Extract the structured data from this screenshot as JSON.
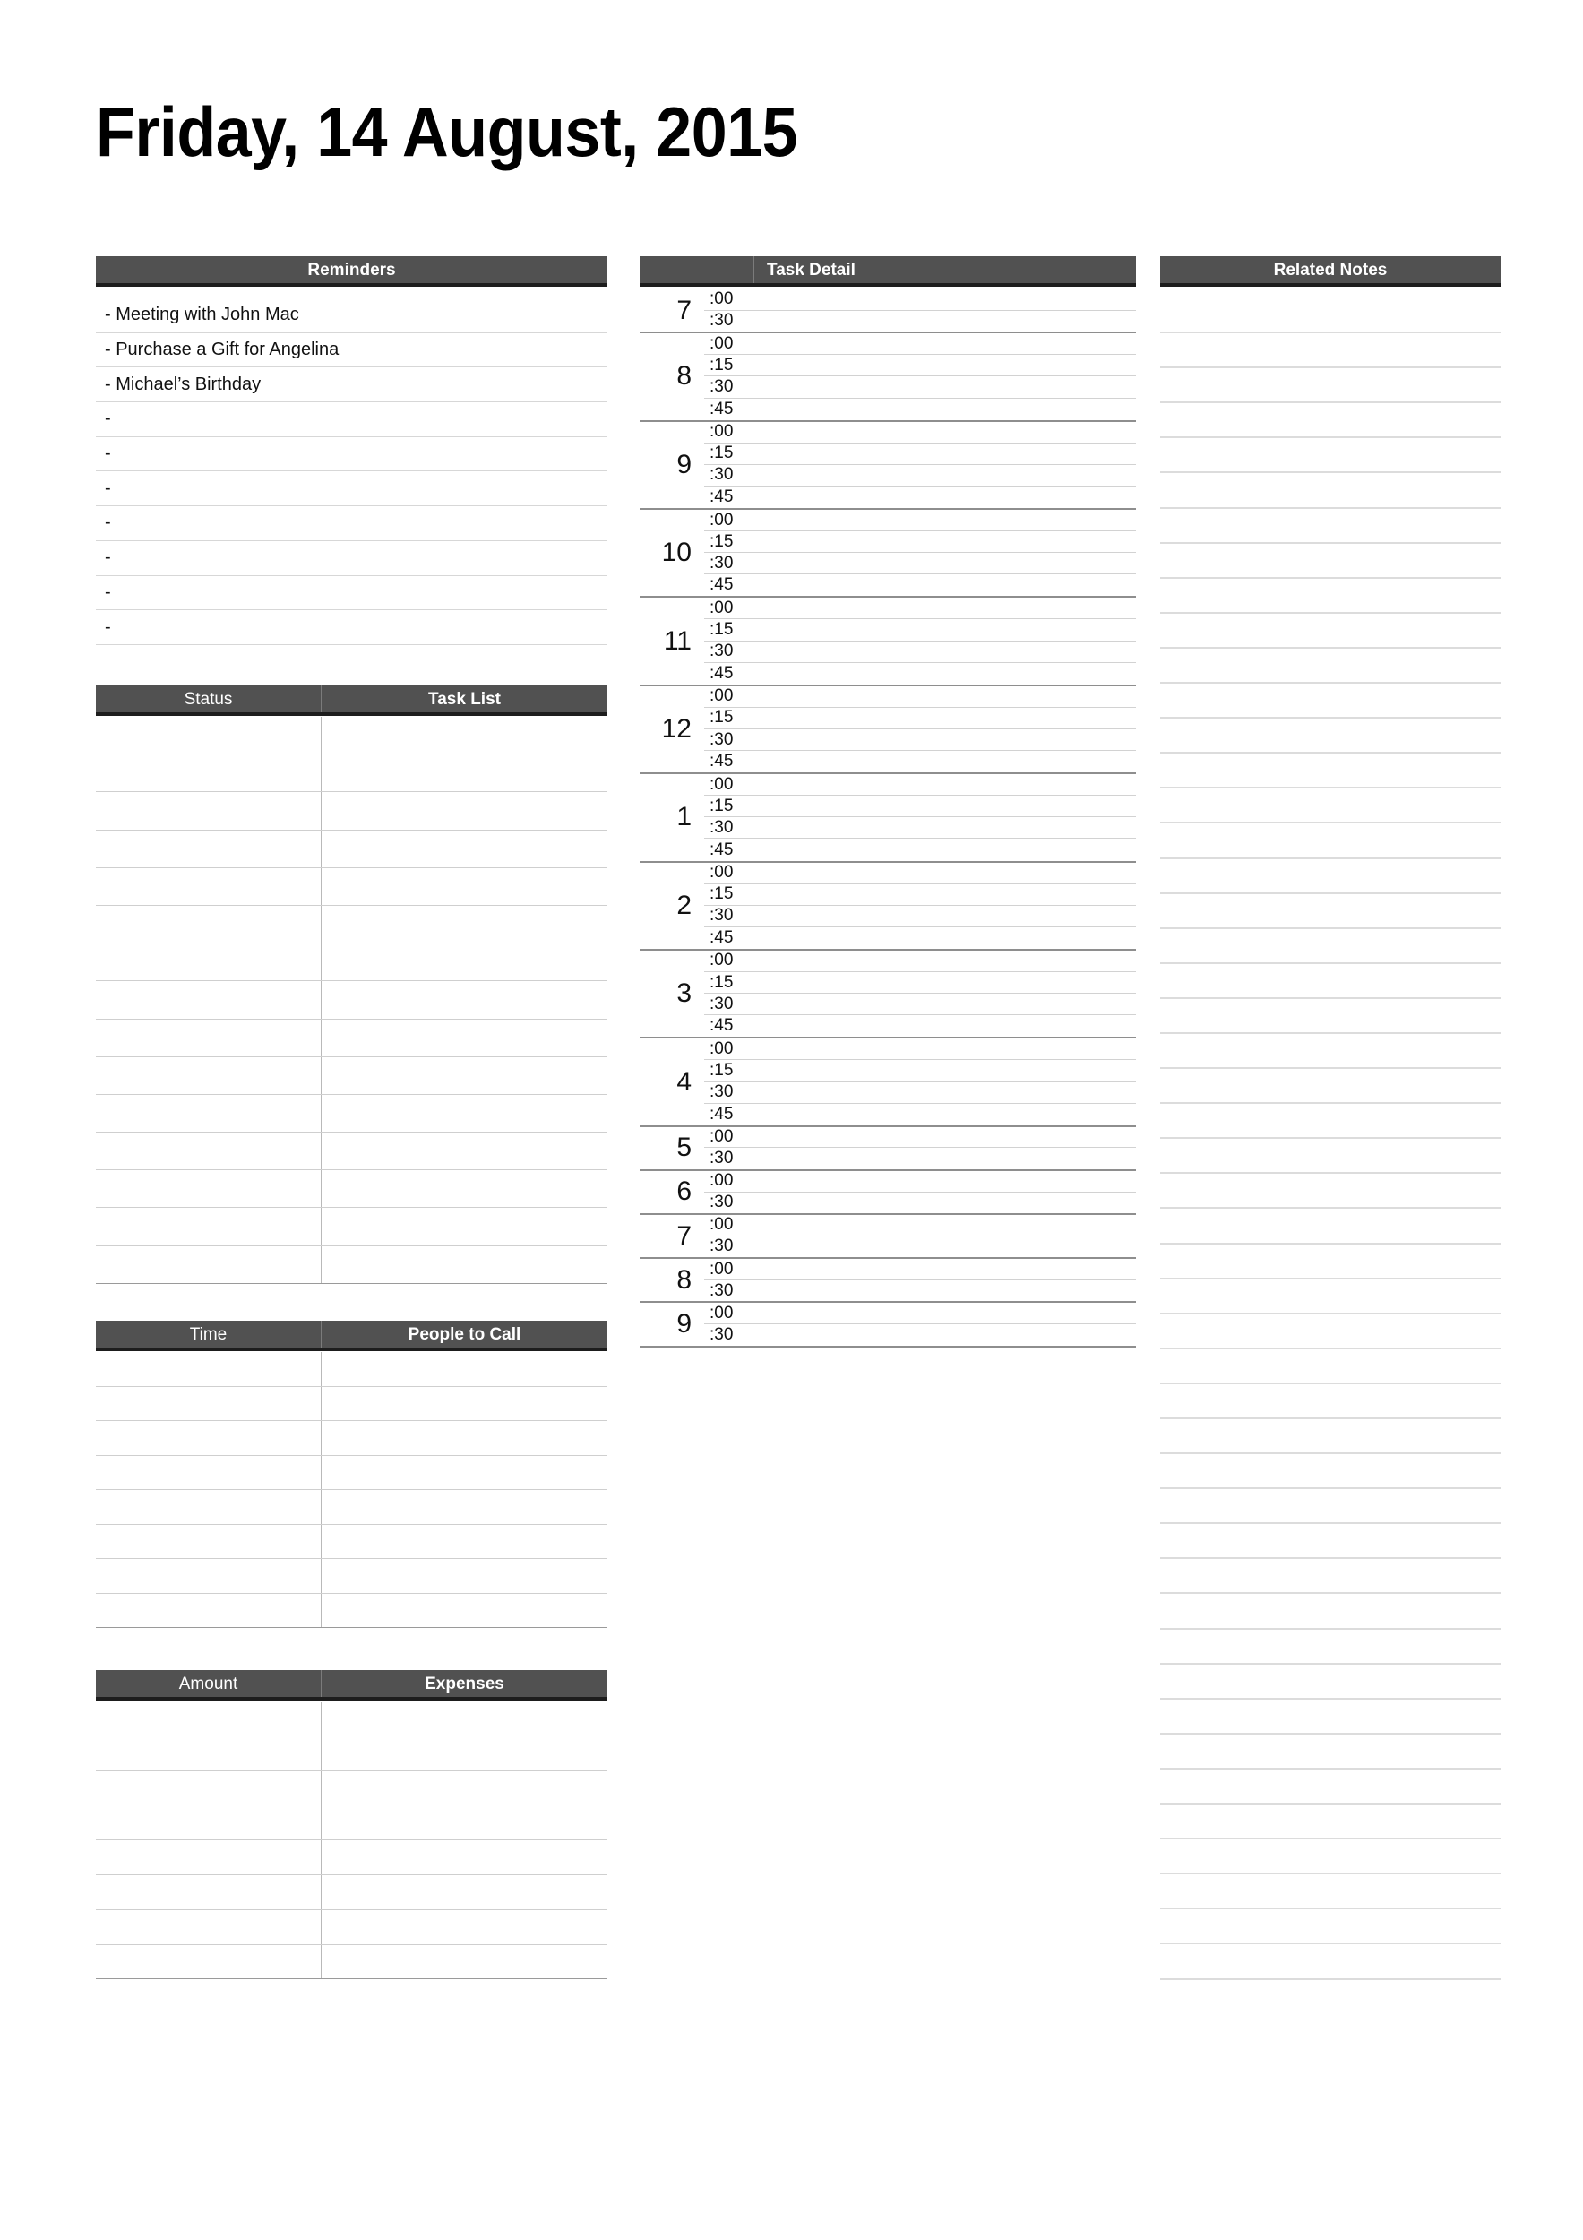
{
  "page": {
    "title": "Friday, 14 August, 2015",
    "background_color": "#ffffff",
    "header_bar_color": "#515151",
    "header_text_color": "#ffffff",
    "rule_color": "#d2d2d2"
  },
  "reminders": {
    "header": "Reminders",
    "items": [
      "- Meeting with John Mac",
      "- Purchase a Gift for Angelina",
      "- Michael’s Birthday",
      "-",
      "-",
      "-",
      "-",
      "-",
      "-",
      "-"
    ]
  },
  "task_list": {
    "header_left": "Status",
    "header_right": "Task List",
    "rows": [
      {
        "status": "",
        "task": ""
      },
      {
        "status": "",
        "task": ""
      },
      {
        "status": "",
        "task": ""
      },
      {
        "status": "",
        "task": ""
      },
      {
        "status": "",
        "task": ""
      },
      {
        "status": "",
        "task": ""
      },
      {
        "status": "",
        "task": ""
      },
      {
        "status": "",
        "task": ""
      },
      {
        "status": "",
        "task": ""
      },
      {
        "status": "",
        "task": ""
      },
      {
        "status": "",
        "task": ""
      },
      {
        "status": "",
        "task": ""
      },
      {
        "status": "",
        "task": ""
      },
      {
        "status": "",
        "task": ""
      },
      {
        "status": "",
        "task": ""
      }
    ]
  },
  "people_to_call": {
    "header_left": "Time",
    "header_right": "People to Call",
    "rows": [
      {
        "time": "",
        "person": ""
      },
      {
        "time": "",
        "person": ""
      },
      {
        "time": "",
        "person": ""
      },
      {
        "time": "",
        "person": ""
      },
      {
        "time": "",
        "person": ""
      },
      {
        "time": "",
        "person": ""
      },
      {
        "time": "",
        "person": ""
      },
      {
        "time": "",
        "person": ""
      }
    ]
  },
  "expenses": {
    "header_left": "Amount",
    "header_right": "Expenses",
    "rows": [
      {
        "amount": "",
        "expense": ""
      },
      {
        "amount": "",
        "expense": ""
      },
      {
        "amount": "",
        "expense": ""
      },
      {
        "amount": "",
        "expense": ""
      },
      {
        "amount": "",
        "expense": ""
      },
      {
        "amount": "",
        "expense": ""
      },
      {
        "amount": "",
        "expense": ""
      },
      {
        "amount": "",
        "expense": ""
      }
    ]
  },
  "task_detail": {
    "header": "Task Detail",
    "hours": [
      {
        "hour": "7",
        "slots": [
          ":00",
          ":30"
        ],
        "details": [
          "",
          ""
        ]
      },
      {
        "hour": "8",
        "slots": [
          ":00",
          ":15",
          ":30",
          ":45"
        ],
        "details": [
          "",
          "",
          "",
          ""
        ]
      },
      {
        "hour": "9",
        "slots": [
          ":00",
          ":15",
          ":30",
          ":45"
        ],
        "details": [
          "",
          "",
          "",
          ""
        ]
      },
      {
        "hour": "10",
        "slots": [
          ":00",
          ":15",
          ":30",
          ":45"
        ],
        "details": [
          "",
          "",
          "",
          ""
        ]
      },
      {
        "hour": "11",
        "slots": [
          ":00",
          ":15",
          ":30",
          ":45"
        ],
        "details": [
          "",
          "",
          "",
          ""
        ]
      },
      {
        "hour": "12",
        "slots": [
          ":00",
          ":15",
          ":30",
          ":45"
        ],
        "details": [
          "",
          "",
          "",
          ""
        ]
      },
      {
        "hour": "1",
        "slots": [
          ":00",
          ":15",
          ":30",
          ":45"
        ],
        "details": [
          "",
          "",
          "",
          ""
        ]
      },
      {
        "hour": "2",
        "slots": [
          ":00",
          ":15",
          ":30",
          ":45"
        ],
        "details": [
          "",
          "",
          "",
          ""
        ]
      },
      {
        "hour": "3",
        "slots": [
          ":00",
          ":15",
          ":30",
          ":45"
        ],
        "details": [
          "",
          "",
          "",
          ""
        ]
      },
      {
        "hour": "4",
        "slots": [
          ":00",
          ":15",
          ":30",
          ":45"
        ],
        "details": [
          "",
          "",
          "",
          ""
        ]
      },
      {
        "hour": "5",
        "slots": [
          ":00",
          ":30"
        ],
        "details": [
          "",
          ""
        ]
      },
      {
        "hour": "6",
        "slots": [
          ":00",
          ":30"
        ],
        "details": [
          "",
          ""
        ]
      },
      {
        "hour": "7",
        "slots": [
          ":00",
          ":30"
        ],
        "details": [
          "",
          ""
        ]
      },
      {
        "hour": "8",
        "slots": [
          ":00",
          ":30"
        ],
        "details": [
          "",
          ""
        ]
      },
      {
        "hour": "9",
        "slots": [
          ":00",
          ":30"
        ],
        "details": [
          "",
          ""
        ]
      }
    ]
  },
  "related_notes": {
    "header": "Related Notes",
    "lines": [
      "",
      "",
      "",
      "",
      "",
      "",
      "",
      "",
      "",
      "",
      "",
      "",
      "",
      "",
      "",
      "",
      "",
      "",
      "",
      "",
      "",
      "",
      "",
      "",
      "",
      "",
      "",
      "",
      "",
      "",
      "",
      "",
      "",
      "",
      "",
      "",
      "",
      "",
      "",
      "",
      "",
      "",
      "",
      "",
      "",
      "",
      "",
      ""
    ]
  }
}
